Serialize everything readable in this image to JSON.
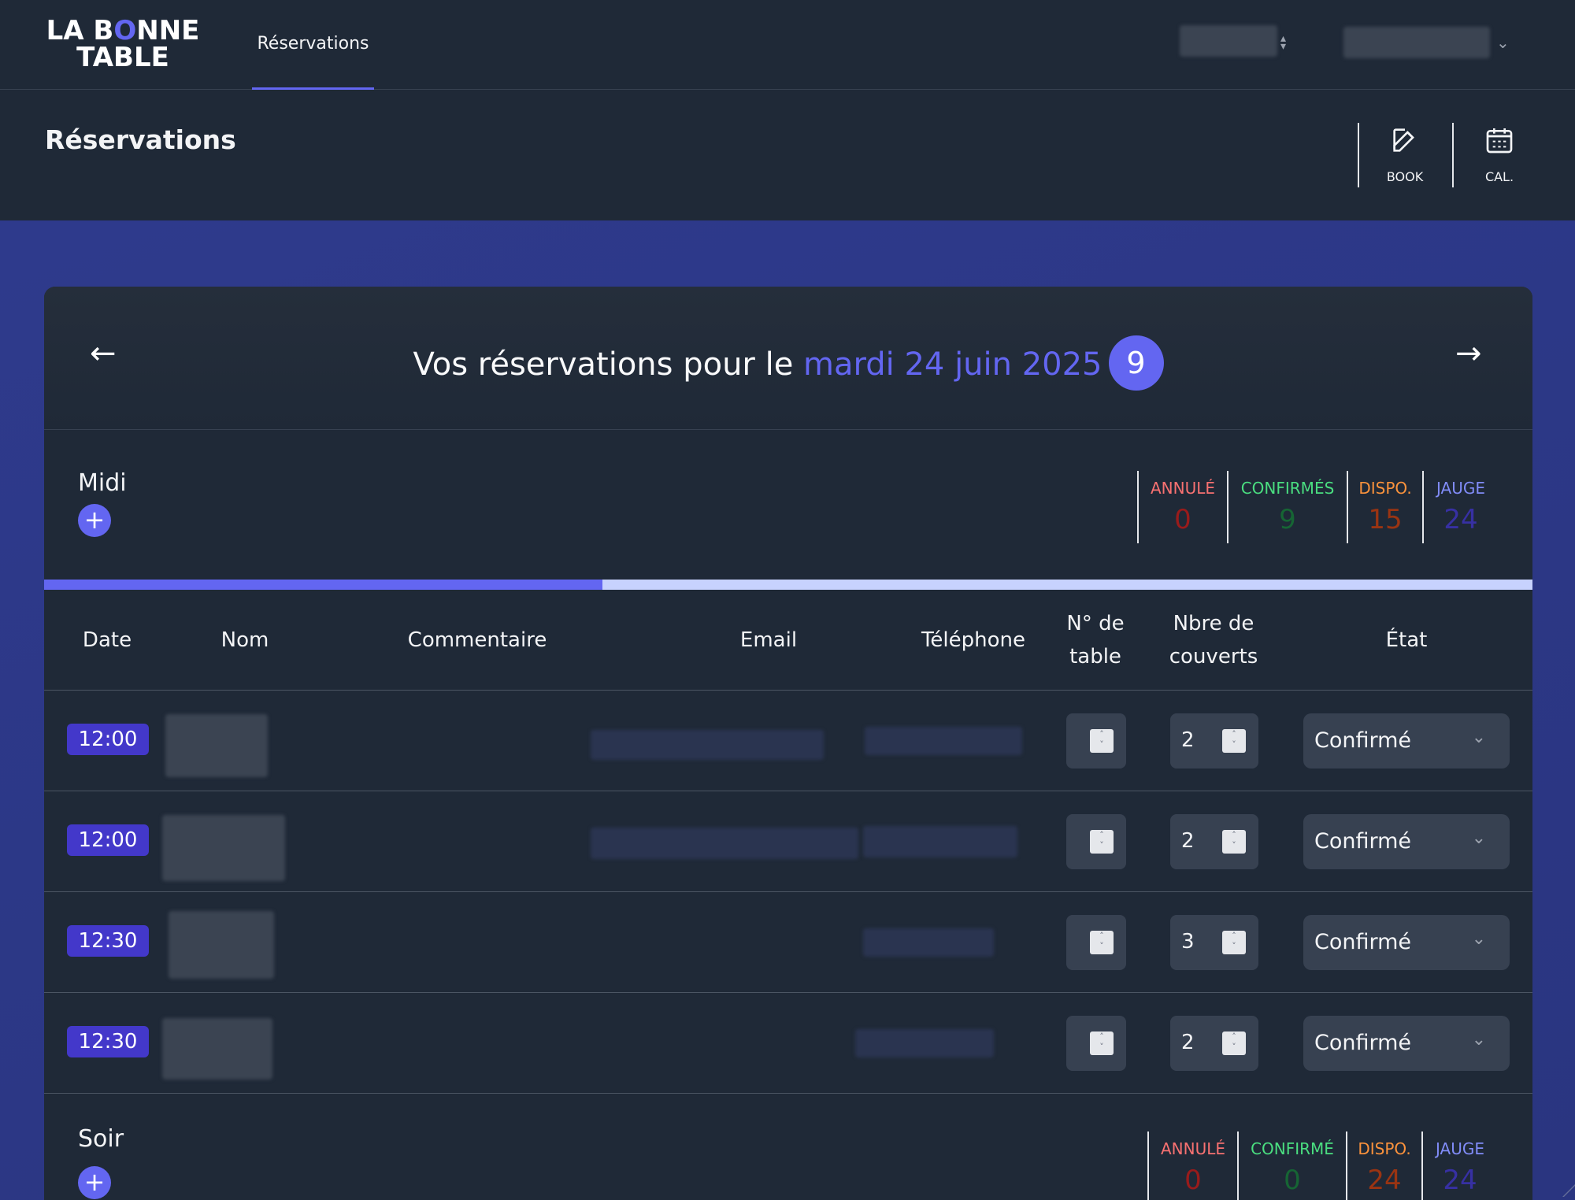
{
  "nav": {
    "logo_line1_a": "LA B",
    "logo_line1_o": "O",
    "logo_line1_b": "NNE",
    "logo_line2": "TABLE",
    "tab_reservations": "Réservations"
  },
  "header": {
    "title": "Réservations",
    "book_label": "BOOK",
    "cal_label": "CAL.",
    "book_icon": "pencil-square-icon",
    "cal_icon": "calendar-icon"
  },
  "card": {
    "prefix": "Vos réservations pour le ",
    "date": "mardi 24 juin 2025",
    "count": "9",
    "prev_arrow": "←",
    "next_arrow": "→"
  },
  "midi": {
    "name": "Midi",
    "add": "+",
    "progress_fraction": 0.375,
    "stats": [
      {
        "key": "ANNULÉ",
        "value": "0"
      },
      {
        "key": "CONFIRMÉS",
        "value": "9"
      },
      {
        "key": "DISPO.",
        "value": "15"
      },
      {
        "key": "JAUGE",
        "value": "24"
      }
    ]
  },
  "table": {
    "headers": {
      "date": "Date",
      "nom": "Nom",
      "commentaire": "Commentaire",
      "email": "Email",
      "telephone": "Téléphone",
      "table_no": "N° de table",
      "couverts": "Nbre de couverts",
      "etat": "État"
    },
    "rows": [
      {
        "time": "12:00",
        "couverts": "2",
        "etat": "Confirmé"
      },
      {
        "time": "12:00",
        "couverts": "2",
        "etat": "Confirmé"
      },
      {
        "time": "12:30",
        "couverts": "3",
        "etat": "Confirmé"
      },
      {
        "time": "12:30",
        "couverts": "2",
        "etat": "Confirmé"
      }
    ]
  },
  "soir": {
    "name": "Soir",
    "add": "+",
    "stats": [
      {
        "key": "ANNULÉ",
        "value": "0"
      },
      {
        "key": "CONFIRMÉ",
        "value": "0"
      },
      {
        "key": "DISPO.",
        "value": "24"
      },
      {
        "key": "JAUGE",
        "value": "24"
      }
    ]
  },
  "colors": {
    "accent": "#6366f1",
    "badge": "#4338ca",
    "background": "#1f2937"
  }
}
